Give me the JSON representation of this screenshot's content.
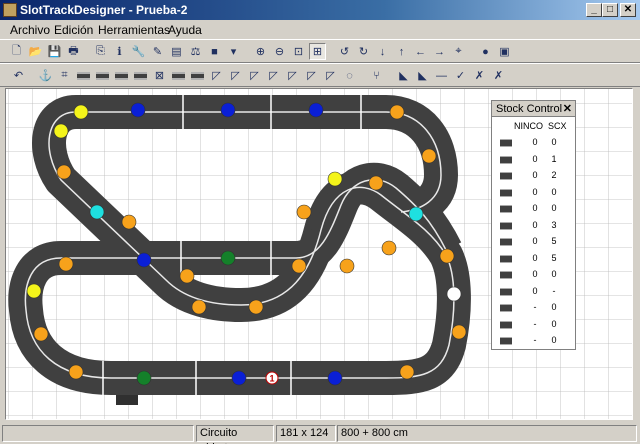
{
  "window": {
    "title": "SlotTrackDesigner - Prueba-2",
    "minimize": "_",
    "maximize": "□",
    "close": "✕"
  },
  "menu": [
    {
      "label": "Archivo"
    },
    {
      "label": "Edición"
    },
    {
      "label": "Herramientas"
    },
    {
      "label": "Ayuda"
    }
  ],
  "toolbar1": [
    {
      "name": "new-file-icon",
      "glyph": "🗋"
    },
    {
      "name": "open-folder-icon",
      "glyph": "📂"
    },
    {
      "name": "save-icon",
      "glyph": "💾"
    },
    {
      "name": "print-icon",
      "glyph": "🖶"
    },
    {
      "name": "copy-icon",
      "glyph": "⎘"
    },
    {
      "name": "info-icon",
      "glyph": "ℹ"
    },
    {
      "name": "tools-icon",
      "glyph": "🔧"
    },
    {
      "name": "edit-pencil-icon",
      "glyph": "✎"
    },
    {
      "name": "book-icon",
      "glyph": "▤"
    },
    {
      "name": "balance-icon",
      "glyph": "⚖"
    },
    {
      "name": "color-picker-icon",
      "glyph": "■"
    },
    {
      "name": "dropdown-arrow-icon",
      "glyph": "▾"
    },
    {
      "name": "zoom-in-icon",
      "glyph": "⊕"
    },
    {
      "name": "zoom-out-icon",
      "glyph": "⊖"
    },
    {
      "name": "zoom-fit-icon",
      "glyph": "⊡"
    },
    {
      "name": "grid-icon",
      "glyph": "⊞"
    },
    {
      "name": "rotate-left-icon",
      "glyph": "↺"
    },
    {
      "name": "rotate-right-icon",
      "glyph": "↻"
    },
    {
      "name": "arrow-down-icon",
      "glyph": "↓"
    },
    {
      "name": "arrow-up-icon",
      "glyph": "↑"
    },
    {
      "name": "arrow-left-icon",
      "glyph": "←"
    },
    {
      "name": "arrow-right-icon",
      "glyph": "→"
    },
    {
      "name": "center-icon",
      "glyph": "⌖"
    },
    {
      "name": "colors-icon",
      "glyph": "●"
    },
    {
      "name": "layers-icon",
      "glyph": "▣"
    }
  ],
  "toolbar2": [
    {
      "name": "undo-icon",
      "glyph": "↶"
    },
    {
      "name": "anchor-icon",
      "glyph": "⚓"
    },
    {
      "name": "track-crossing-icon",
      "glyph": "⌗"
    },
    {
      "name": "track-straight-icon",
      "glyph": ""
    },
    {
      "name": "track-straight-half-icon",
      "glyph": ""
    },
    {
      "name": "track-straight-quarter-icon",
      "glyph": ""
    },
    {
      "name": "track-straight-short-icon",
      "glyph": ""
    },
    {
      "name": "track-cross-icon",
      "glyph": "⊠"
    },
    {
      "name": "track-pit-icon",
      "glyph": ""
    },
    {
      "name": "track-lane-change-icon",
      "glyph": ""
    },
    {
      "name": "track-curve-1-icon",
      "glyph": "◸"
    },
    {
      "name": "track-curve-2-icon",
      "glyph": "◸"
    },
    {
      "name": "track-curve-3-icon",
      "glyph": "◸"
    },
    {
      "name": "track-curve-4-icon",
      "glyph": "◸"
    },
    {
      "name": "track-curve-5-icon",
      "glyph": "◸"
    },
    {
      "name": "track-curve-6-icon",
      "glyph": "◸"
    },
    {
      "name": "track-curve-7-icon",
      "glyph": "◸"
    },
    {
      "name": "track-hairpin-icon",
      "glyph": "◌"
    },
    {
      "name": "track-split-icon",
      "glyph": "⑂"
    },
    {
      "name": "track-border-1-icon",
      "glyph": "◣"
    },
    {
      "name": "track-border-2-icon",
      "glyph": "◣"
    },
    {
      "name": "track-border-3-icon",
      "glyph": "—"
    },
    {
      "name": "track-border-4-icon",
      "glyph": "✓"
    },
    {
      "name": "delete-icon",
      "glyph": "✗"
    },
    {
      "name": "delete-all-icon",
      "glyph": "✗"
    }
  ],
  "stock": {
    "title": "Stock Control",
    "close": "✕",
    "col_ninco": "NINCO",
    "col_scx": "SCX",
    "rows": [
      {
        "ninco": "0",
        "scx": "0"
      },
      {
        "ninco": "0",
        "scx": "1"
      },
      {
        "ninco": "0",
        "scx": "2"
      },
      {
        "ninco": "0",
        "scx": "0"
      },
      {
        "ninco": "0",
        "scx": "0"
      },
      {
        "ninco": "0",
        "scx": "3"
      },
      {
        "ninco": "0",
        "scx": "5"
      },
      {
        "ninco": "0",
        "scx": "5"
      },
      {
        "ninco": "0",
        "scx": "0"
      },
      {
        "ninco": "0",
        "scx": "-"
      },
      {
        "ninco": "-",
        "scx": "0"
      },
      {
        "ninco": "-",
        "scx": "0"
      },
      {
        "ninco": "-",
        "scx": "0"
      }
    ]
  },
  "markers": {
    "blue": "#0a1fd6",
    "orange": "#f7a21b",
    "yellow": "#f4f41a",
    "cyan": "#1ee0e0",
    "green": "#14802a",
    "white": "#ffffff",
    "start_label": "1"
  },
  "status": {
    "panel1": "",
    "state": "Circuito abierto",
    "size": "181 x 124 cm",
    "area": "800 + 800 cm"
  }
}
